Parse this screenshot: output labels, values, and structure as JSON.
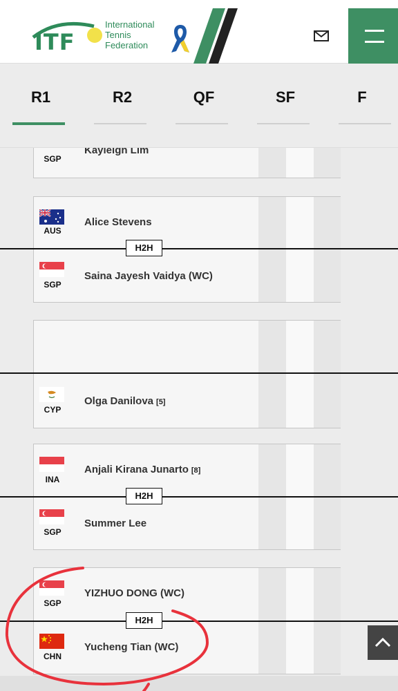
{
  "header": {
    "logo_text": "ITF",
    "org_name_line1": "International",
    "org_name_line2": "Tennis",
    "org_name_line3": "Federation",
    "mail_icon": "mail-icon",
    "menu_icon": "hamburger-icon"
  },
  "tabs": [
    {
      "label": "R1",
      "active": true
    },
    {
      "label": "R2",
      "active": false
    },
    {
      "label": "QF",
      "active": false
    },
    {
      "label": "SF",
      "active": false
    },
    {
      "label": "F",
      "active": false
    }
  ],
  "matches": [
    {
      "players": [
        {
          "country": "SGP",
          "name": "Kayleigh Lim",
          "seed": ""
        }
      ]
    },
    {
      "h2h_label": "H2H",
      "players": [
        {
          "country": "AUS",
          "name": "Alice Stevens",
          "seed": ""
        },
        {
          "country": "SGP",
          "name": "Saina Jayesh  Vaidya (WC)",
          "seed": ""
        }
      ]
    },
    {
      "players": [
        {
          "country": "",
          "name": "",
          "seed": ""
        },
        {
          "country": "CYP",
          "name": "Olga Danilova",
          "seed": "[5]"
        }
      ]
    },
    {
      "h2h_label": "H2H",
      "players": [
        {
          "country": "INA",
          "name": "Anjali Kirana Junarto",
          "seed": "[8]"
        },
        {
          "country": "SGP",
          "name": "Summer Lee",
          "seed": ""
        }
      ]
    },
    {
      "h2h_label": "H2H",
      "players": [
        {
          "country": "SGP",
          "name": "YIZHUO DONG (WC)",
          "seed": ""
        },
        {
          "country": "CHN",
          "name": "Yucheng Tian (WC)",
          "seed": ""
        }
      ]
    }
  ],
  "colors": {
    "accent": "#3e8f63",
    "annotation": "#e8323c"
  }
}
